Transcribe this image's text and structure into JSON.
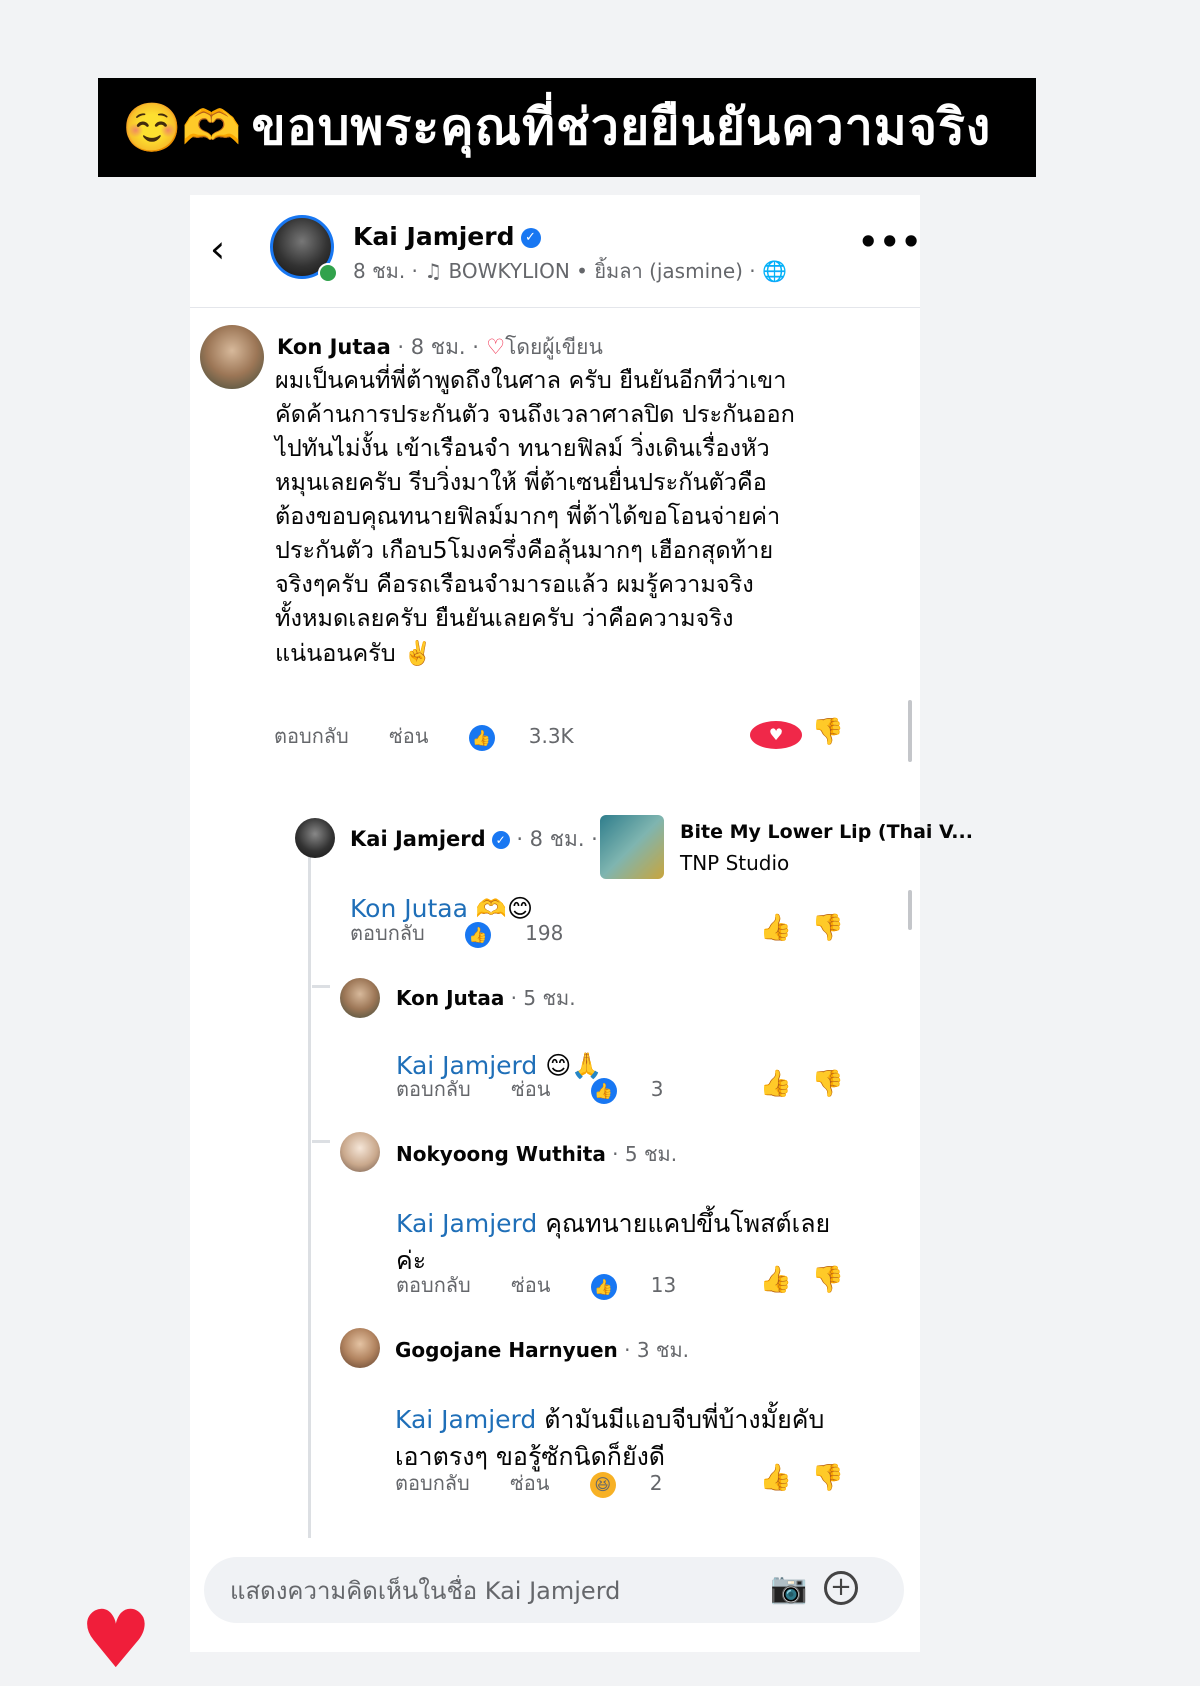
{
  "banner": {
    "emoji": "☺️🫶",
    "text": "ขอบพระคุณที่ช่วยยืนยันความจริง"
  },
  "header": {
    "back_icon": "chevron-left-icon",
    "page_name": "Kai Jamjerd",
    "meta": "8 ชม. · ♫ BOWKYLION • ยิ้มลา (jasmine) · 🌐",
    "more_icon": "•••"
  },
  "comments": [
    {
      "name": "Kon Jutaa",
      "time": " · 8 ชม. ·",
      "author_badge": "โดยผู้เขียน",
      "text": "ผมเป็นคนที่พี่ต้าพูดถึงในศาล ครับ ยืนยันอีกทีว่าเขา\nคัดค้านการประกันตัว จนถึงเวลาศาลปิด ประกันออก\nไปทันไม่งั้น เข้าเรือนจำ ทนายฟิลม์ วิ่งเดินเรื่องหัว\nหมุนเลยครับ รีบวิ่งมาให้ พี่ต้าเซนยื่นประกันตัวคือ\nต้องขอบคุณทนายฟิลม์มากๆ พี่ต้าได้ขอโอนจ่ายค่า\nประกันตัว เกือบ5โมงครึ่งคือลุ้นมากๆ  เฮือกสุดท้าย\nจริงๆครับ คือรถเรือนจำมารอแล้ว ผมรู้ความจริง\nทั้งหมดเลยครับ ยืนยันเลยครับ ว่าคือความจริง\nแน่นอนครับ ✌️",
      "reply": "ตอบกลับ",
      "hide": "ซ่อน",
      "likes": "3.3K"
    },
    {
      "name": "Kai Jamjerd",
      "time": " · 8 ชม. ·",
      "mention": "Kon Jutaa",
      "text": " 🫶😊",
      "reply": "ตอบกลับ",
      "likes": "198",
      "song_title": "Bite My Lower Lip (Thai V...",
      "song_artist": "TNP Studio"
    },
    {
      "name": "Kon Jutaa",
      "time": " · 5 ชม.",
      "mention": "Kai Jamjerd",
      "text": " 😊🙏",
      "reply": "ตอบกลับ",
      "hide": "ซ่อน",
      "likes": "3"
    },
    {
      "name": "Nokyoong Wuthita",
      "time": " · 5 ชม.",
      "mention": "Kai Jamjerd",
      "text": " คุณทนายแคปขึ้นโพสต์เลย\nค่ะ",
      "reply": "ตอบกลับ",
      "hide": "ซ่อน",
      "likes": "13"
    },
    {
      "name": "Gogojane Harnyuen",
      "time": " · 3 ชม.",
      "mention": "Kai Jamjerd",
      "text": " ต้ามันมีแอบจีบพี่บ้างมั้ยคับ\nเอาตรงๆ ขอรู้ซักนิดก็ยังดี",
      "reply": "ตอบกลับ",
      "hide": "ซ่อน",
      "likes": "2"
    }
  ],
  "compose": {
    "placeholder": "แสดงความคิดเห็นในชื่อ Kai Jamjerd"
  },
  "colors": {
    "accent": "#1877f2",
    "mention": "#1f6fb8",
    "heart": "#f02849",
    "banner_bg": "#000000"
  }
}
